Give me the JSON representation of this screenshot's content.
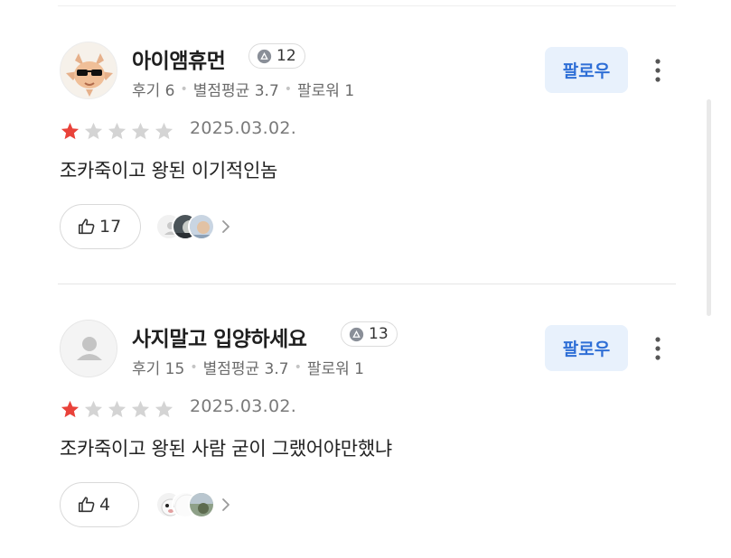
{
  "colors": {
    "accent": "#2f6fd6",
    "follow_bg": "#e8f1fc",
    "star_filled": "#e9423a",
    "star_empty": "#d4d4d4"
  },
  "reviews": [
    {
      "user": {
        "name": "아이앰휴먼",
        "avatar_icon": "cartoon-sunglasses-avatar",
        "level": "12",
        "review_count_label": "후기 6",
        "avg_rating_label": "별점평균 3.7",
        "followers_label": "팔로워 1"
      },
      "follow_label": "팔로우",
      "rating": 1,
      "max_rating": 5,
      "date": "2025.03.02.",
      "text": "조카죽이고 왕된 이기적인놈",
      "likes": "17"
    },
    {
      "user": {
        "name": "사지말고 입양하세요",
        "avatar_icon": "default-person-avatar",
        "level": "13",
        "review_count_label": "후기 15",
        "avg_rating_label": "별점평균 3.7",
        "followers_label": "팔로워 1"
      },
      "follow_label": "팔로우",
      "rating": 1,
      "max_rating": 5,
      "date": "2025.03.02.",
      "text": "조카죽이고 왕된 사람 굳이 그랬어야만했냐",
      "likes": "4"
    }
  ]
}
